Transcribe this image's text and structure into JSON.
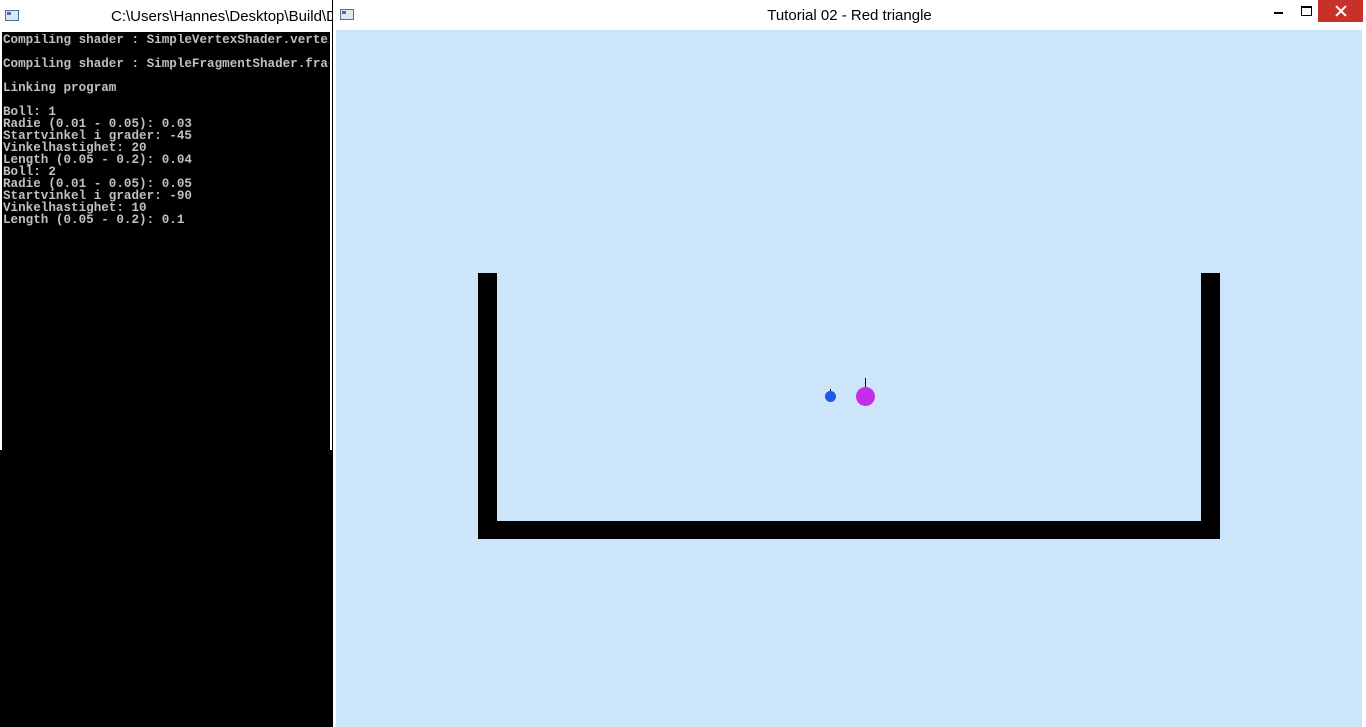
{
  "console": {
    "title": "C:\\Users\\Hannes\\Desktop\\Build\\D",
    "icon": "console-window-icon",
    "lines": [
      "Compiling shader : SimpleVertexShader.vertexshader",
      "",
      "Compiling shader : SimpleFragmentShader.fragmentshader",
      "",
      "Linking program",
      "",
      "Boll: 1",
      "Radie (0.01 - 0.05): 0.03",
      "Startvinkel i grader: -45",
      "Vinkelhastighet: 20",
      "Length (0.05 - 0.2): 0.04",
      "Boll: 2",
      "Radie (0.01 - 0.05): 0.05",
      "Startvinkel i grader: -90",
      "Vinkelhastighet: 10",
      "Length (0.05 - 0.2): 0.1"
    ],
    "text_color": "#c0c0c0",
    "background": "#000000"
  },
  "gl_window": {
    "title": "Tutorial 02 - Red triangle",
    "icon": "application-window-icon",
    "controls": {
      "minimize_icon": "minimize-icon",
      "maximize_icon": "maximize-icon",
      "close_icon": "close-icon",
      "close_color": "#c7312a"
    },
    "scene": {
      "background": "#cce5fb",
      "container_color": "#000000",
      "balls": [
        {
          "name": "boll-1",
          "color": "#1a56ef",
          "radius": 0.03,
          "start_angle_deg": -45,
          "angular_velocity": 20,
          "length": 0.04
        },
        {
          "name": "boll-2",
          "color": "#c42fe5",
          "radius": 0.05,
          "start_angle_deg": -90,
          "angular_velocity": 10,
          "length": 0.1
        }
      ]
    }
  }
}
